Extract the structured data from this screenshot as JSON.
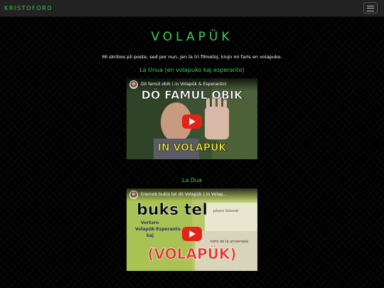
{
  "navbar": {
    "brand": "KRISTOFORO",
    "menu_icon": "hamburger-icon"
  },
  "page": {
    "title": "VOLAPÜK",
    "intro": "Mi skribos pli poste, sed por nun, jen la tri filmetoj, kiujn mi faris en volapuko."
  },
  "sections": [
    {
      "heading": "La Unua (en volapuko kaj esperanto)",
      "video": {
        "title": "Dö famül obik (.in Volapük & Esperanto)",
        "caption_top": "DÖ FAMÜL OBIK",
        "caption_bottom": "IN VOLAPÜK"
      }
    },
    {
      "heading": "La Dua",
      "video": {
        "title": "Eremob bukis tel dö Volapük (.in Volap...",
        "caption_top": "buks tel",
        "caption_bottom": "(VOLAPÜK)",
        "book_lines": [
          "Vortaro",
          "Volapük-Esperanto",
          "kaj",
          "torio de la universala",
          "Johann Schmidt"
        ]
      }
    }
  ],
  "colors": {
    "accent": "#37d14f",
    "navbar": "#222222",
    "play": "#e62117",
    "caption_red": "#e53228",
    "caption_yellow": "#f4e34a"
  }
}
